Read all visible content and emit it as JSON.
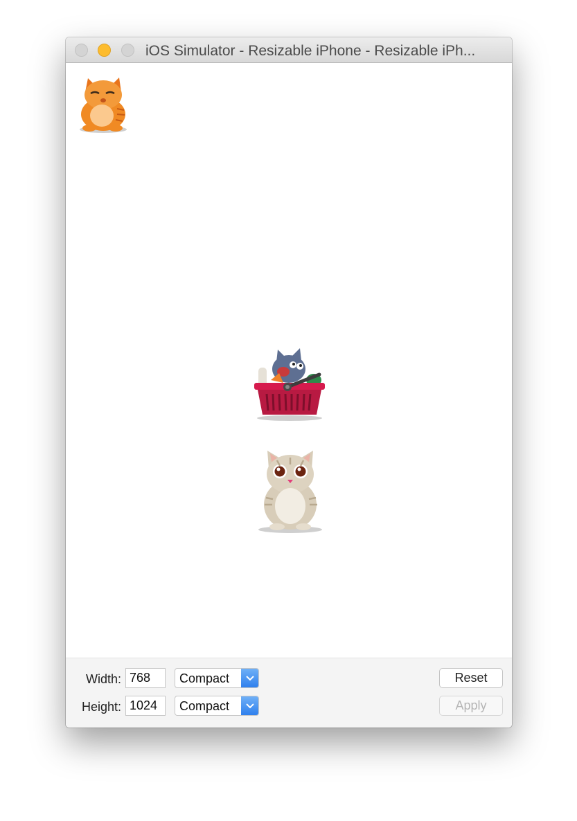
{
  "window": {
    "title": "iOS Simulator - Resizable iPhone - Resizable iPh..."
  },
  "stickers": [
    {
      "name": "orange-cat-sticker"
    },
    {
      "name": "gray-cat-basket-sticker"
    },
    {
      "name": "cream-cat-sticker"
    }
  ],
  "panel": {
    "width_label": "Width:",
    "width_value": "768",
    "width_class": "Compact",
    "height_label": "Height:",
    "height_value": "1024",
    "height_class": "Compact",
    "reset_label": "Reset",
    "apply_label": "Apply"
  },
  "colors": {
    "minimize": "#fdbc2e",
    "select_accent": "#2f80ed"
  }
}
